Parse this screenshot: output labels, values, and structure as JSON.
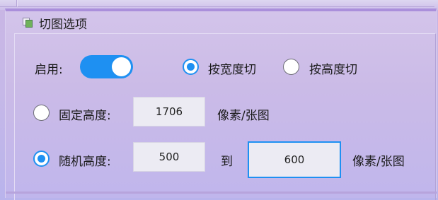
{
  "panel": {
    "title": "切图选项"
  },
  "enable": {
    "label": "启用:",
    "on": true
  },
  "mode": {
    "by_width_label": "按宽度切",
    "by_height_label": "按高度切",
    "selected": "by_width"
  },
  "fixed_height": {
    "label": "固定高度:",
    "value": "1706",
    "unit": "像素/张图",
    "selected": false
  },
  "random_height": {
    "label": "随机高度:",
    "min": "500",
    "to_label": "到",
    "max": "600",
    "unit": "像素/张图",
    "selected": true
  },
  "colors": {
    "accent": "#1e90f2",
    "panel_border": "#aa8fdb"
  }
}
